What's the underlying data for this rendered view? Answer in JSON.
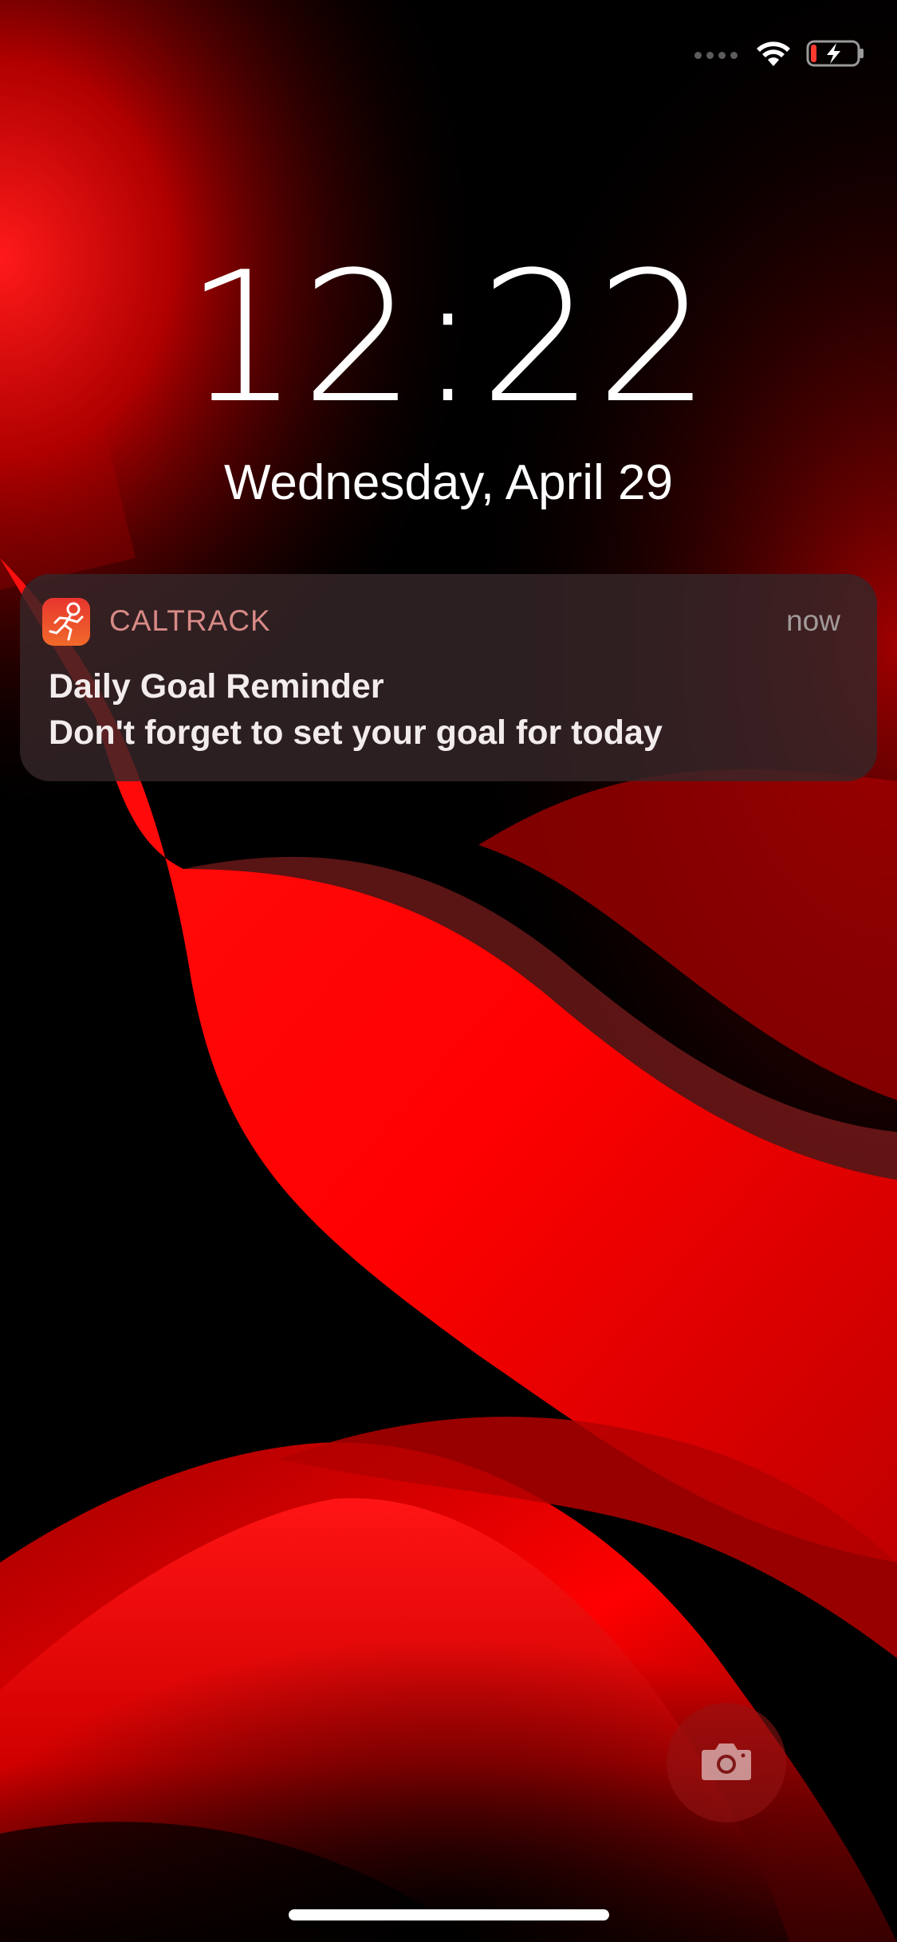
{
  "status_bar": {
    "signal_icon": "cellular-signal-dots",
    "wifi_icon": "wifi-icon",
    "battery_icon": "battery-charging-icon",
    "battery_level_fraction": 0.12,
    "battery_low_color": "#ff3b30"
  },
  "lock_screen": {
    "time": "12:22",
    "date": "Wednesday, April 29"
  },
  "notification": {
    "app_icon": "running-figure-icon",
    "app_name": "CALTRACK",
    "time": "now",
    "title": "Daily Goal Reminder",
    "body": "Don't forget to set your goal for today"
  },
  "quick_actions": {
    "camera_icon": "camera-icon"
  },
  "colors": {
    "wallpaper_red": "#ff0000",
    "background": "#000000",
    "app_icon_gradient_top": "#e8352f",
    "app_icon_gradient_bottom": "#f06a2a"
  }
}
